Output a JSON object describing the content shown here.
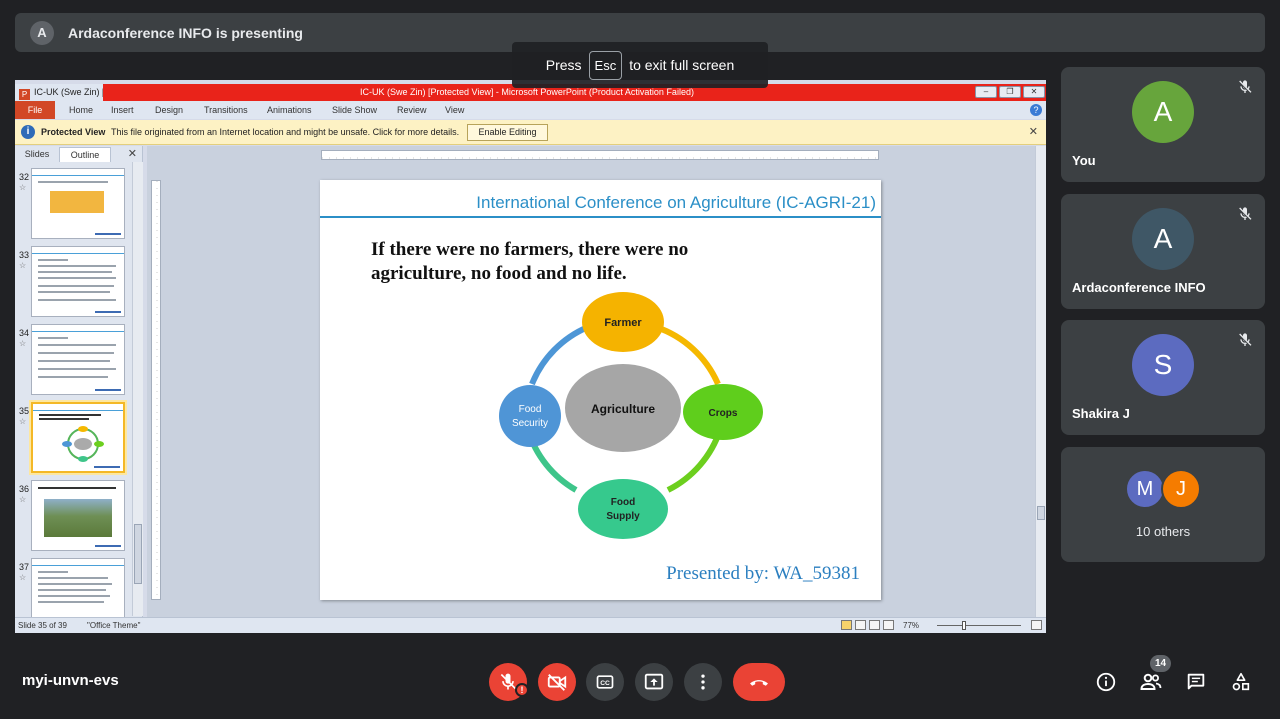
{
  "topbar": {
    "avatar_letter": "A",
    "text": "Ardaconference INFO is presenting"
  },
  "fullscreen_hint": {
    "prefix": "Press",
    "key": "Esc",
    "suffix": "to exit full screen"
  },
  "ppt": {
    "window_title_left": "IC-UK (Swe Zin) [I",
    "window_title": "IC-UK (Swe Zin) [Protected View] - Microsoft PowerPoint (Product Activation Failed)",
    "menu": [
      "File",
      "Home",
      "Insert",
      "Design",
      "Transitions",
      "Animations",
      "Slide Show",
      "Review",
      "View"
    ],
    "protected": {
      "label": "Protected View",
      "message": "This file originated from an Internet location and might be unsafe. Click for more details.",
      "button": "Enable Editing"
    },
    "panel_tabs": [
      "Slides",
      "Outline"
    ],
    "thumbs": [
      {
        "num": "32",
        "title": "Irrigation Scheduling of Chinese Field (University)"
      },
      {
        "num": "33",
        "title": "Conclusion"
      },
      {
        "num": "34",
        "title": "Conclusion"
      },
      {
        "num": "35",
        "title": "If there were no farmers, there were no agriculture, no food and no life."
      },
      {
        "num": "36",
        "title": "Farmers and agriculture in their life work"
      },
      {
        "num": "37",
        "title": "References"
      }
    ],
    "status": {
      "slide": "Slide 35 of 39",
      "theme": "\"Office Theme\"",
      "zoom": "77%"
    }
  },
  "slide": {
    "title": "International Conference on Agriculture (IC-AGRI-21)",
    "quote_line1": "If there were no farmers, there were no",
    "quote_line2": "agriculture, no food and no life.",
    "presented": "Presented by:  WA_59381",
    "diagram": {
      "center": "Agriculture",
      "farmer": "Farmer",
      "crops": "Crops",
      "supply_1": "Food",
      "supply_2": "Supply",
      "security_1": "Food",
      "security_2": "Security"
    }
  },
  "participants": [
    {
      "letter": "A",
      "name": "You",
      "color": "#67a53c"
    },
    {
      "letter": "A",
      "name": "Ardaconference INFO",
      "color": "#3f5766"
    },
    {
      "letter": "S",
      "name": "Shakira J",
      "color": "#5c6bc0"
    }
  ],
  "others": {
    "letters": [
      "M",
      "J"
    ],
    "colors": [
      "#5c6bc0",
      "#f57c00"
    ],
    "label": "10 others"
  },
  "meeting_code": "myi-unvn-evs",
  "participant_count": "14",
  "colors": {
    "red": "#ea4335",
    "panel": "#3c4043",
    "bg": "#202124"
  }
}
